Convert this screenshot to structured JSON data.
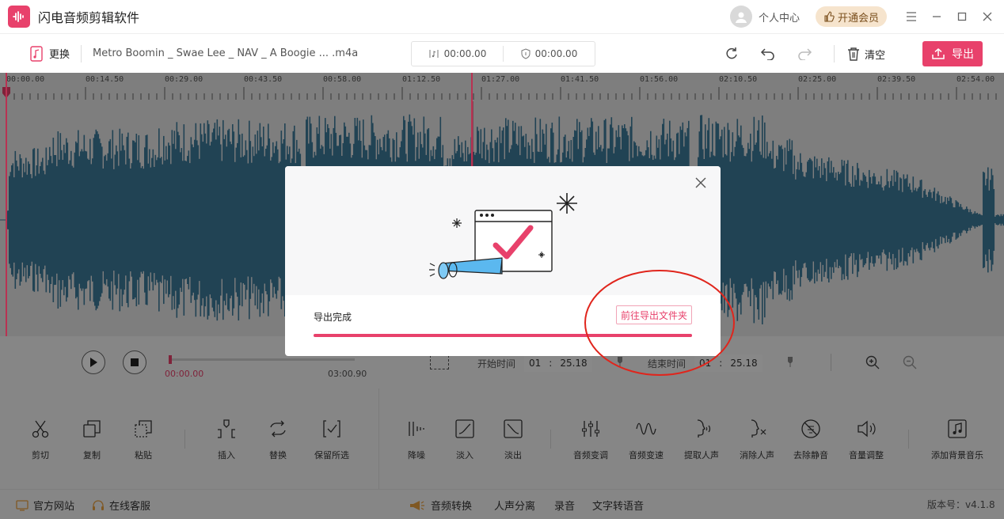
{
  "app": {
    "title": "闪电音频剪辑软件",
    "user_center": "个人中心",
    "vip": "开通会员"
  },
  "toolbar": {
    "replace": "更换",
    "filename": "Metro Boomin _ Swae Lee _ NAV _ A Boogie ... .m4a",
    "time_total": "00:00.00",
    "time_selection": "00:00.00",
    "clear": "清空",
    "export": "导出"
  },
  "timeline": {
    "ticks": [
      "00:00.00",
      "00:14.50",
      "00:29.00",
      "00:43.50",
      "00:58.00",
      "01:12.50",
      "01:27.00",
      "01:41.50",
      "01:56.00",
      "02:10.50",
      "02:25.00",
      "02:39.50",
      "02:54.00"
    ]
  },
  "player": {
    "current_time": "00:00.00",
    "total_time": "03:00.90",
    "progress_fraction": 0.0,
    "start_label": "开始时间",
    "start_min": "01",
    "start_sec": "25.18",
    "end_label": "结束时间",
    "end_min": "01",
    "end_sec": "25.18",
    "separator": ":"
  },
  "functions": {
    "cut": "剪切",
    "copy": "复制",
    "paste": "粘贴",
    "insert": "插入",
    "replace": "替换",
    "keep": "保留所选",
    "denoise": "降噪",
    "fade_in": "淡入",
    "fade_out": "淡出",
    "pitch": "音频变调",
    "speed": "音频变速",
    "extract_voice": "提取人声",
    "remove_voice": "消除人声",
    "remove_silence": "去除静音",
    "volume": "音量调整",
    "add_bgm": "添加背景音乐"
  },
  "footer": {
    "website": "官方网站",
    "service": "在线客服",
    "convert": "音频转换",
    "separate": "人声分离",
    "record": "录音",
    "tts": "文字转语音",
    "version": "版本号：v4.1.8"
  },
  "modal": {
    "status": "导出完成",
    "open_folder": "前往导出文件夹",
    "progress_fraction": 1.0
  },
  "colors": {
    "accent": "#e8416b",
    "waveform": "#3d7a9a",
    "vip_bg": "#f6e4cd"
  }
}
